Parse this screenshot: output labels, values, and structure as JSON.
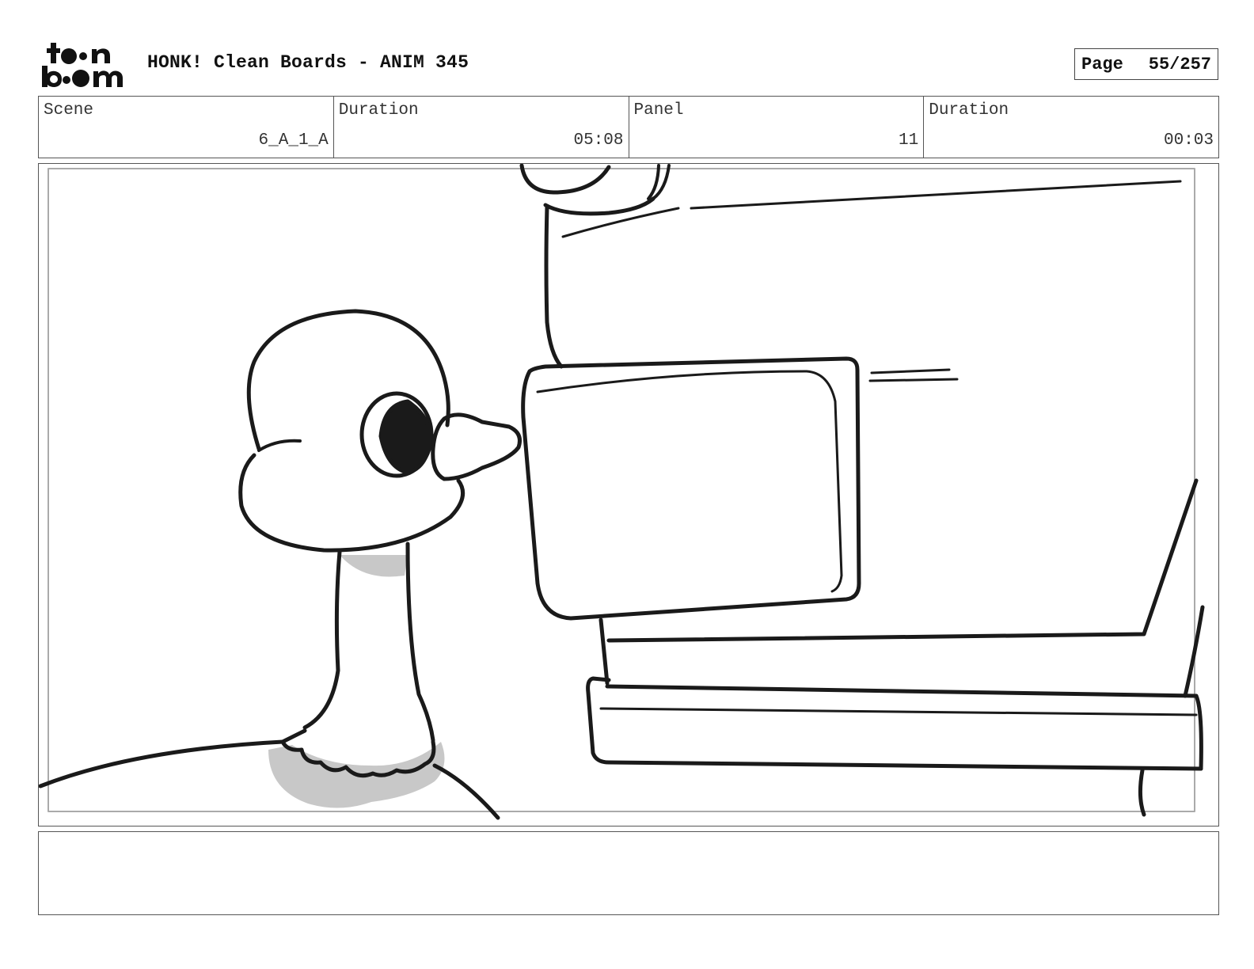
{
  "header": {
    "logo_text": "toon boom",
    "title": "HONK! Clean Boards - ANIM 345",
    "page_label": "Page",
    "page_value": "55/257"
  },
  "info": {
    "scene_label": "Scene",
    "scene_value": "6_A_1_A",
    "scene_duration_label": "Duration",
    "scene_duration_value": "05:08",
    "panel_label": "Panel",
    "panel_value": "11",
    "panel_duration_label": "Duration",
    "panel_duration_value": "00:03"
  },
  "panel": {
    "image_subject": "goose-near-machine-drawing"
  },
  "notes": {
    "text": ""
  }
}
